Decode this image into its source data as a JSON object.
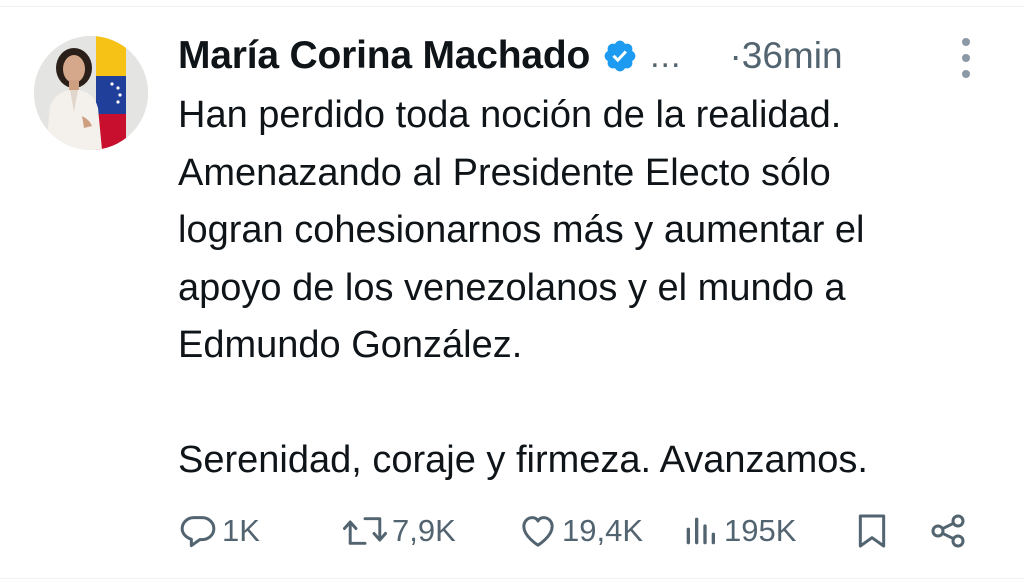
{
  "tweet": {
    "author_name": "María Corina Machado",
    "handle_ellipsis": "...",
    "timestamp": "·36min",
    "text": "Han perdido toda noción de la realidad.\nAmenazando al Presidente Electo sólo\nlogran cohesionarnos más y aumentar el\napoyo de los venezolanos y el mundo a\nEdmundo González.\n\nSerenidad, coraje y firmeza. Avanzamos.",
    "verified_color": "#1d9bf0",
    "icons": {
      "more": "more-vertical-icon",
      "reply": "reply-icon",
      "retweet": "retweet-icon",
      "like": "heart-icon",
      "views": "views-icon",
      "bookmark": "bookmark-icon",
      "share": "share-icon",
      "verified": "verified-badge-icon"
    },
    "metrics": {
      "replies": "1K",
      "retweets": "7,9K",
      "likes": "19,4K",
      "views": "195K"
    }
  },
  "colors": {
    "text": "#0f1419",
    "secondary": "#536471",
    "accent": "#1d9bf0"
  }
}
